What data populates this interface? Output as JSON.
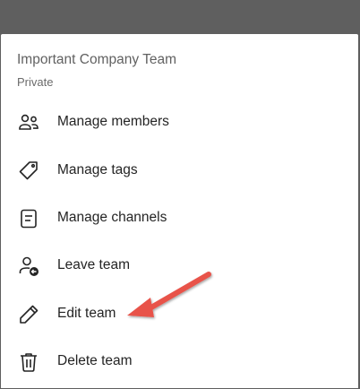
{
  "team": {
    "name": "Important Company Team",
    "privacy": "Private"
  },
  "menu": {
    "items": [
      {
        "label": "Manage members",
        "icon": "people-icon"
      },
      {
        "label": "Manage tags",
        "icon": "tag-icon"
      },
      {
        "label": "Manage channels",
        "icon": "channel-list-icon"
      },
      {
        "label": "Leave team",
        "icon": "person-leave-icon"
      },
      {
        "label": "Edit team",
        "icon": "pencil-icon"
      },
      {
        "label": "Delete team",
        "icon": "trash-icon"
      }
    ]
  },
  "annotation": {
    "arrow_color": "#e8524a",
    "points_to": "Edit team"
  },
  "colors": {
    "backdrop": "#5f5f5f",
    "sheet": "#ffffff",
    "text_primary": "#242424",
    "text_secondary": "#616161"
  }
}
